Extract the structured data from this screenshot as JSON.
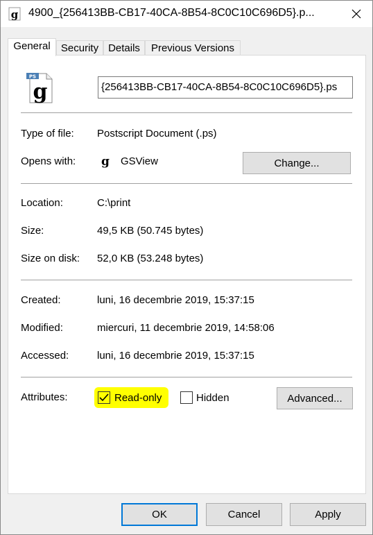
{
  "window": {
    "title": "4900_{256413BB-CB17-40CA-8B54-8C0C10C696D5}.p...",
    "close_icon": "close-icon"
  },
  "tabs": [
    {
      "label": "General",
      "active": true
    },
    {
      "label": "Security",
      "active": false
    },
    {
      "label": "Details",
      "active": false
    },
    {
      "label": "Previous Versions",
      "active": false
    }
  ],
  "general": {
    "filename": "{256413BB-CB17-40CA-8B54-8C0C10C696D5}.ps",
    "file_icon": "ghostscript-ps-icon",
    "type_label": "Type of file:",
    "type_value": "Postscript Document (.ps)",
    "opens_label": "Opens with:",
    "opens_value": "GSView",
    "change_button": "Change...",
    "location_label": "Location:",
    "location_value": "C:\\print",
    "size_label": "Size:",
    "size_value": "49,5 KB (50.745 bytes)",
    "size_on_disk_label": "Size on disk:",
    "size_on_disk_value": "52,0 KB (53.248 bytes)",
    "created_label": "Created:",
    "created_value": "luni, 16 decembrie 2019, 15:37:15",
    "modified_label": "Modified:",
    "modified_value": "miercuri, 11 decembrie 2019, 14:58:06",
    "accessed_label": "Accessed:",
    "accessed_value": "luni, 16 decembrie 2019, 15:37:15",
    "attributes_label": "Attributes:",
    "readonly_label": "Read-only",
    "readonly_checked": true,
    "hidden_label": "Hidden",
    "hidden_checked": false,
    "advanced_button": "Advanced..."
  },
  "footer": {
    "ok": "OK",
    "cancel": "Cancel",
    "apply": "Apply"
  },
  "colors": {
    "highlight": "#ffff00",
    "focus_border": "#0078d7",
    "button_bg": "#e1e1e1"
  }
}
